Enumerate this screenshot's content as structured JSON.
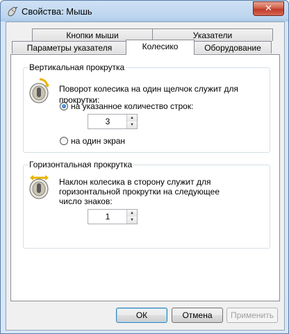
{
  "window": {
    "title": "Свойства: Мышь",
    "close_label": "✕",
    "icon": "mouse-icon"
  },
  "tabs": {
    "row1": [
      {
        "label": "Кнопки мыши"
      },
      {
        "label": "Указатели"
      }
    ],
    "row2": [
      {
        "label": "Параметры указателя"
      },
      {
        "label": "Колесико",
        "active": true
      },
      {
        "label": "Оборудование"
      }
    ]
  },
  "vertical_scroll": {
    "title": "Вертикальная прокрутка",
    "description": "Поворот колесика на один щелчок служит для прокрутки:",
    "option_lines": "на указанное количество строк:",
    "option_lines_selected": true,
    "lines_value": "3",
    "option_screen": "на один экран",
    "icon": "mouse-wheel-icon"
  },
  "horizontal_scroll": {
    "title": "Горизонтальная прокрутка",
    "description_line1": "Наклон колесика в сторону служит для",
    "description_line2": "горизонтальной прокрутки на следующее",
    "description_line3": "число знаков:",
    "chars_value": "1",
    "icon": "mouse-wheel-tilt-icon"
  },
  "buttons": {
    "ok": "ОК",
    "cancel": "Отмена",
    "apply": "Применить"
  }
}
